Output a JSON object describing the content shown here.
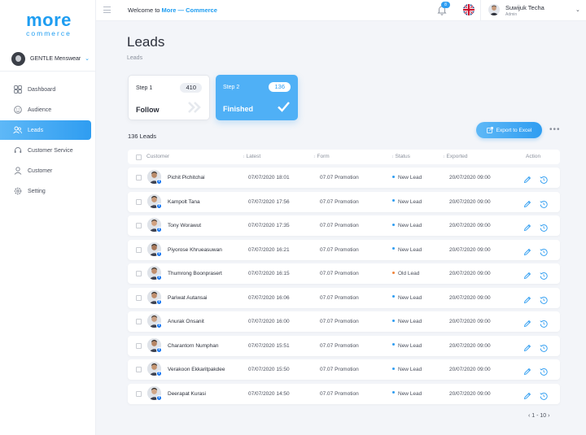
{
  "brand": {
    "main": "more",
    "sub": "commerce",
    "color": "#1e9df1"
  },
  "store": {
    "name": "GENTLE Menswear"
  },
  "sidebar": {
    "items": [
      {
        "label": "Dashboard",
        "icon": "dashboard-icon",
        "active": false
      },
      {
        "label": "Audience",
        "icon": "audience-icon",
        "active": false
      },
      {
        "label": "Leads",
        "icon": "leads-icon",
        "active": true
      },
      {
        "label": "Customer Service",
        "icon": "headset-icon",
        "active": false
      },
      {
        "label": "Customer",
        "icon": "customer-icon",
        "active": false
      },
      {
        "label": "Setting",
        "icon": "gear-icon",
        "active": false
      }
    ]
  },
  "topbar": {
    "welcome_prefix": "Welcome to ",
    "welcome_brand": "More — Commerce",
    "notification_count": "8",
    "user_name": "Suwijuk Techa",
    "user_role": "Admin"
  },
  "page": {
    "title": "Leads",
    "breadcrumb": "Leads"
  },
  "steps": [
    {
      "label": "Step 1",
      "count": "410",
      "name": "Follow"
    },
    {
      "label": "Step 2",
      "count": "136",
      "name": "Finished"
    }
  ],
  "leads_count": "136 Leads",
  "export_label": "Export to Excel",
  "more_label": "•••",
  "table": {
    "headers": {
      "customer": "Customer",
      "latest": "Latest",
      "form": "Form",
      "status": "Status",
      "exported": "Exported",
      "action": "Action"
    },
    "rows": [
      {
        "name": "Pichit Pichitchai",
        "latest": "07/07/2020  18:01",
        "form": "07.07 Promotion",
        "status": "New Lead",
        "exported": "20/07/2020  09:00"
      },
      {
        "name": "Kampolt Tana",
        "latest": "07/07/2020  17:56",
        "form": "07.07 Promotion",
        "status": "New Lead",
        "exported": "20/07/2020  09:00"
      },
      {
        "name": "Tony Worawut",
        "latest": "07/07/2020  17:35",
        "form": "07.07 Promotion",
        "status": "New Lead",
        "exported": "20/07/2020  09:00"
      },
      {
        "name": "Piyorose Khrueasuwan",
        "latest": "07/07/2020  16:21",
        "form": "07.07 Promotion",
        "status": "New Lead",
        "exported": "20/07/2020  09:00"
      },
      {
        "name": "Thumrong Boonprasert",
        "latest": "07/07/2020  16:15",
        "form": "07.07 Promotion",
        "status": "Old Lead",
        "exported": "20/07/2020  09:00"
      },
      {
        "name": "Pariwat Autansai",
        "latest": "07/07/2020  16:06",
        "form": "07.07 Promotion",
        "status": "New Lead",
        "exported": "20/07/2020  09:00"
      },
      {
        "name": "Anurak  Onsanit",
        "latest": "07/07/2020  16:00",
        "form": "07.07 Promotion",
        "status": "New Lead",
        "exported": "20/07/2020  09:00"
      },
      {
        "name": "Charantorn Numphan",
        "latest": "07/07/2020  15:51",
        "form": "07.07 Promotion",
        "status": "New Lead",
        "exported": "20/07/2020  09:00"
      },
      {
        "name": "Verakoon Ekkaritpakdee",
        "latest": "07/07/2020  15:50",
        "form": "07.07 Promotion",
        "status": "New Lead",
        "exported": "20/07/2020  09:00"
      },
      {
        "name": "Deerapat Kurasi",
        "latest": "07/07/2020  14:50",
        "form": "07.07 Promotion",
        "status": "New Lead",
        "exported": "20/07/2020  09:00"
      }
    ]
  },
  "status_colors": {
    "New Lead": "#2f9df1",
    "Old Lead": "#f0843c"
  },
  "pagination": {
    "label": "1 - 10"
  }
}
